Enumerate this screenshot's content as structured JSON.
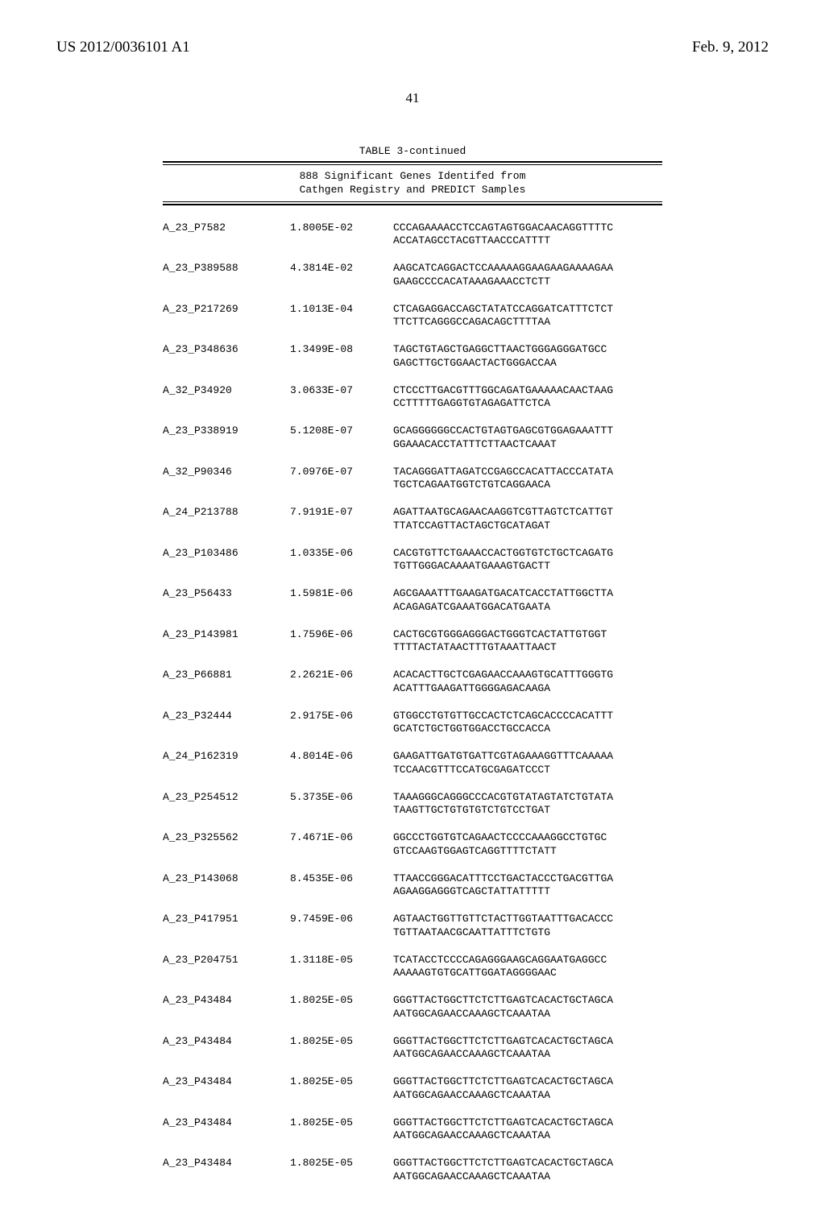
{
  "header": {
    "left": "US 2012/0036101 A1",
    "right": "Feb. 9, 2012"
  },
  "page_number": "41",
  "table": {
    "title": "TABLE 3-continued",
    "subtitle_line1": "888 Significant Genes Identifed from",
    "subtitle_line2": "Cathgen Registry and PREDICT Samples",
    "rows": [
      {
        "id": "A_23_P7582",
        "val": "1.8005E-02",
        "seq1": "CCCAGAAAACCTCCAGTAGTGGACAACAGGTTTTC",
        "seq2": "ACCATAGCCTACGTTAACCCATTTT"
      },
      {
        "id": "A_23_P389588",
        "val": "4.3814E-02",
        "seq1": "AAGCATCAGGACTCCAAAAAGGAAGAAGAAAAGAA",
        "seq2": "GAAGCCCCACATAAAGAAACCTCTT"
      },
      {
        "id": "A_23_P217269",
        "val": "1.1013E-04",
        "seq1": "CTCAGAGGACCAGCTATATCCAGGATCATTTCTCT",
        "seq2": "TTCTTCAGGGCCAGACAGCTTTTAA"
      },
      {
        "id": "A_23_P348636",
        "val": "1.3499E-08",
        "seq1": "TAGCTGTAGCTGAGGCTTAACTGGGAGGGATGCC",
        "seq2": "GAGCTTGCTGGAACTACTGGGACCAA"
      },
      {
        "id": "A_32_P34920",
        "val": "3.0633E-07",
        "seq1": "CTCCCTTGACGTTTGGCAGATGAAAAACAACTAAG",
        "seq2": "CCTTTTTGAGGTGTAGAGATTCTCA"
      },
      {
        "id": "A_23_P338919",
        "val": "5.1208E-07",
        "seq1": "GCAGGGGGGCCACTGTAGTGAGCGTGGAGAAATTT",
        "seq2": "GGAAACACCTATTTCTTAACTCAAAT"
      },
      {
        "id": "A_32_P90346",
        "val": "7.0976E-07",
        "seq1": "TACAGGGATTAGATCCGAGCCACATTACCCATATA",
        "seq2": "TGCTCAGAATGGTCTGTCAGGAACA"
      },
      {
        "id": "A_24_P213788",
        "val": "7.9191E-07",
        "seq1": "AGATTAATGCAGAACAAGGTCGTTAGTCTCATTGT",
        "seq2": "TTATCCAGTTACTAGCTGCATAGAT"
      },
      {
        "id": "A_23_P103486",
        "val": "1.0335E-06",
        "seq1": "CACGTGTTCTGAAACCACTGGTGTCTGCTCAGATG",
        "seq2": "TGTTGGGACAAAATGAAAGTGACTT"
      },
      {
        "id": "A_23_P56433",
        "val": "1.5981E-06",
        "seq1": "AGCGAAATTTGAAGATGACATCACCTATTGGCTTA",
        "seq2": "ACAGAGATCGAAATGGACATGAATA"
      },
      {
        "id": "A_23_P143981",
        "val": "1.7596E-06",
        "seq1": "CACTGCGTGGGAGGGACTGGGTCACTATTGTGGT",
        "seq2": "TTTTACTATAACTTTGTAAATTAACT"
      },
      {
        "id": "A_23_P66881",
        "val": "2.2621E-06",
        "seq1": "ACACACTTGCTCGAGAACCAAAGTGCATTTGGGTG",
        "seq2": "ACATTTGAAGATTGGGGAGACAAGA"
      },
      {
        "id": "A_23_P32444",
        "val": "2.9175E-06",
        "seq1": "GTGGCCTGTGTTGCCACTCTCAGCACCCCACATTT",
        "seq2": "GCATCTGCTGGTGGACCTGCCACCA"
      },
      {
        "id": "A_24_P162319",
        "val": "4.8014E-06",
        "seq1": "GAAGATTGATGTGATTCGTAGAAAGGTTTCAAAAA",
        "seq2": "TCCAACGTTTCCATGCGAGATCCCT"
      },
      {
        "id": "A_23_P254512",
        "val": "5.3735E-06",
        "seq1": "TAAAGGGCAGGGCCCACGTGTATAGTATCTGTATA",
        "seq2": "TAAGTTGCTGTGTGTCTGTCCTGAT"
      },
      {
        "id": "A_23_P325562",
        "val": "7.4671E-06",
        "seq1": "GGCCCTGGTGTCAGAACTCCCCAAAGGCCTGTGC",
        "seq2": "GTCCAAGTGGAGTCAGGTTTTCTATT"
      },
      {
        "id": "A_23_P143068",
        "val": "8.4535E-06",
        "seq1": "TTAACCGGGACATTTCCTGACTACCCTGACGTTGA",
        "seq2": "AGAAGGAGGGTCAGCTATTATTTTT"
      },
      {
        "id": "A_23_P417951",
        "val": "9.7459E-06",
        "seq1": "AGTAACTGGTTGTTCTACTTGGTAATTTGACACCC",
        "seq2": "TGTTAATAACGCAATTATTTCTGTG"
      },
      {
        "id": "A_23_P204751",
        "val": "1.3118E-05",
        "seq1": "TCATACCTCCCCAGAGGGAAGCAGGAATGAGGCC",
        "seq2": "AAAAAGTGTGCATTGGATAGGGGAAC"
      },
      {
        "id": "A_23_P43484",
        "val": "1.8025E-05",
        "seq1": "GGGTTACTGGCTTCTCTTGAGTCACACTGCTAGCA",
        "seq2": "AATGGCAGAACCAAAGCTCAAATAA"
      },
      {
        "id": "A_23_P43484",
        "val": "1.8025E-05",
        "seq1": "GGGTTACTGGCTTCTCTTGAGTCACACTGCTAGCA",
        "seq2": "AATGGCAGAACCAAAGCTCAAATAA"
      },
      {
        "id": "A_23_P43484",
        "val": "1.8025E-05",
        "seq1": "GGGTTACTGGCTTCTCTTGAGTCACACTGCTAGCA",
        "seq2": "AATGGCAGAACCAAAGCTCAAATAA"
      },
      {
        "id": "A_23_P43484",
        "val": "1.8025E-05",
        "seq1": "GGGTTACTGGCTTCTCTTGAGTCACACTGCTAGCA",
        "seq2": "AATGGCAGAACCAAAGCTCAAATAA"
      },
      {
        "id": "A_23_P43484",
        "val": "1.8025E-05",
        "seq1": "GGGTTACTGGCTTCTCTTGAGTCACACTGCTAGCA",
        "seq2": "AATGGCAGAACCAAAGCTCAAATAA"
      }
    ]
  }
}
